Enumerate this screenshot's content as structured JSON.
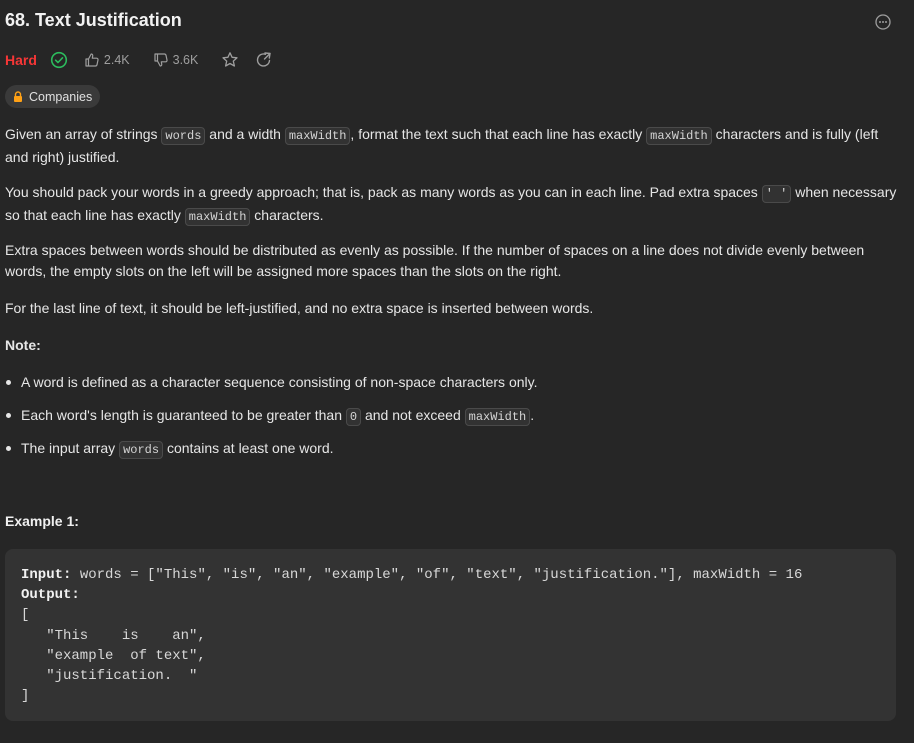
{
  "problem": {
    "title": "68. Text Justification",
    "difficulty": "Hard",
    "likes": "2.4K",
    "dislikes": "3.6K",
    "companies_label": "Companies"
  },
  "description": {
    "p1": {
      "t1": "Given an array of strings ",
      "c1": "words",
      "t2": " and a width ",
      "c2": "maxWidth",
      "t3": ", format the text such that each line has exactly ",
      "c3": "maxWidth",
      "t4": " characters and is fully (left and right) justified."
    },
    "p2": {
      "t1": "You should pack your words in a greedy approach; that is, pack as many words as you can in each line. Pad extra spaces ",
      "c1": "' '",
      "t2": " when necessary so that each line has exactly ",
      "c2": "maxWidth",
      "t3": " characters."
    },
    "p3": "Extra spaces between words should be distributed as evenly as possible. If the number of spaces on a line does not divide evenly between words, the empty slots on the left will be assigned more spaces than the slots on the right.",
    "p4": "For the last line of text, it should be left-justified, and no extra space is inserted between words.",
    "note_heading": "Note:",
    "notes": {
      "n1": "A word is defined as a character sequence consisting of non-space characters only.",
      "n2": {
        "t1": "Each word's length is guaranteed to be greater than ",
        "c1": "0",
        "t2": " and not exceed ",
        "c2": "maxWidth",
        "t3": "."
      },
      "n3": {
        "t1": "The input array ",
        "c1": "words",
        "t2": " contains at least one word."
      }
    }
  },
  "example1": {
    "heading": "Example 1:",
    "input_label": "Input:",
    "input_value": " words = [\"This\", \"is\", \"an\", \"example\", \"of\", \"text\", \"justification.\"], maxWidth = 16",
    "output_label": "Output:",
    "output_lines": [
      "[",
      "   \"This    is    an\",",
      "   \"example  of text\",",
      "   \"justification.  \"",
      "]"
    ]
  },
  "icons": {
    "solved": "check-circle-icon",
    "like": "thumbs-up-icon",
    "dislike": "thumbs-down-icon",
    "star": "star-icon",
    "share": "share-icon",
    "lock": "lock-icon",
    "more": "more-icon"
  },
  "colors": {
    "hard": "#f63636",
    "solved": "#2cbb5d",
    "lock": "#ffa116"
  }
}
